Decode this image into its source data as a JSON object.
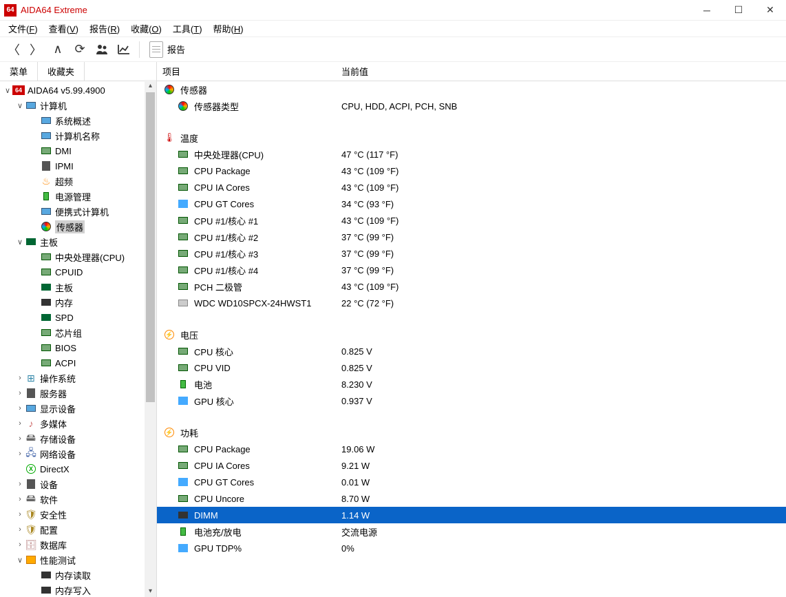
{
  "window": {
    "title": "AIDA64 Extreme",
    "icon_text": "64"
  },
  "menu": [
    {
      "l": "文件(",
      "u": "F",
      "r": ")"
    },
    {
      "l": "查看(",
      "u": "V",
      "r": ")"
    },
    {
      "l": "报告(",
      "u": "R",
      "r": ")"
    },
    {
      "l": "收藏(",
      "u": "O",
      "r": ")"
    },
    {
      "l": "工具(",
      "u": "T",
      "r": ")"
    },
    {
      "l": "帮助(",
      "u": "H",
      "r": ")"
    }
  ],
  "toolbar": {
    "report_label": "报告"
  },
  "sidebar": {
    "tabs": [
      "菜单",
      "收藏夹"
    ],
    "root": "AIDA64 v5.99.4900"
  },
  "tree": [
    {
      "level": 2,
      "exp": "open",
      "icon": "monitor",
      "label": "计算机"
    },
    {
      "level": 3,
      "icon": "monitor",
      "label": "系统概述"
    },
    {
      "level": 3,
      "icon": "monitor",
      "label": "计算机名称"
    },
    {
      "level": 3,
      "icon": "chip",
      "label": "DMI"
    },
    {
      "level": 3,
      "icon": "serv",
      "label": "IPMI"
    },
    {
      "level": 3,
      "icon": "fire",
      "label": "超频"
    },
    {
      "level": 3,
      "icon": "batt",
      "label": "电源管理"
    },
    {
      "level": 3,
      "icon": "monitor",
      "label": "便携式计算机"
    },
    {
      "level": 3,
      "icon": "sensor",
      "label": "传感器",
      "sel": true
    },
    {
      "level": 2,
      "exp": "open",
      "icon": "board",
      "label": "主板"
    },
    {
      "level": 3,
      "icon": "chip",
      "label": "中央处理器(CPU)"
    },
    {
      "level": 3,
      "icon": "chip",
      "label": "CPUID"
    },
    {
      "level": 3,
      "icon": "board",
      "label": "主板"
    },
    {
      "level": 3,
      "icon": "dark",
      "label": "内存"
    },
    {
      "level": 3,
      "icon": "board",
      "label": "SPD"
    },
    {
      "level": 3,
      "icon": "chip",
      "label": "芯片组"
    },
    {
      "level": 3,
      "icon": "chip",
      "label": "BIOS"
    },
    {
      "level": 3,
      "icon": "chip",
      "label": "ACPI"
    },
    {
      "level": 2,
      "exp": "closed",
      "icon": "win",
      "label": "操作系统"
    },
    {
      "level": 2,
      "exp": "closed",
      "icon": "serv",
      "label": "服务器"
    },
    {
      "level": 2,
      "exp": "closed",
      "icon": "monitor",
      "label": "显示设备"
    },
    {
      "level": 2,
      "exp": "closed",
      "icon": "aud",
      "label": "多媒体"
    },
    {
      "level": 2,
      "exp": "closed",
      "icon": "stor",
      "label": "存储设备"
    },
    {
      "level": 2,
      "exp": "closed",
      "icon": "net",
      "label": "网络设备"
    },
    {
      "level": 2,
      "exp": "",
      "icon": "dx",
      "label": "DirectX"
    },
    {
      "level": 2,
      "exp": "closed",
      "icon": "serv",
      "label": "设备"
    },
    {
      "level": 2,
      "exp": "closed",
      "icon": "stor",
      "label": "软件"
    },
    {
      "level": 2,
      "exp": "closed",
      "icon": "sec",
      "label": "安全性"
    },
    {
      "level": 2,
      "exp": "closed",
      "icon": "sec",
      "label": "配置"
    },
    {
      "level": 2,
      "exp": "closed",
      "icon": "db",
      "label": "数据库"
    },
    {
      "level": 2,
      "exp": "open",
      "icon": "perf",
      "label": "性能测试"
    },
    {
      "level": 3,
      "icon": "dark",
      "label": "内存读取"
    },
    {
      "level": 3,
      "icon": "dark",
      "label": "内存写入"
    }
  ],
  "content": {
    "headers": [
      "项目",
      "当前值"
    ],
    "sections": [
      {
        "title": "传感器",
        "icon": "sensor",
        "rows": [
          {
            "icon": "sensor",
            "label": "传感器类型",
            "value": "CPU, HDD, ACPI, PCH, SNB"
          }
        ]
      },
      {
        "title": "温度",
        "icon": "therm",
        "rows": [
          {
            "icon": "chip",
            "label": "中央处理器(CPU)",
            "value": "47 °C  (117 °F)"
          },
          {
            "icon": "chip",
            "label": "CPU Package",
            "value": "43 °C  (109 °F)"
          },
          {
            "icon": "chip",
            "label": "CPU IA Cores",
            "value": "43 °C  (109 °F)"
          },
          {
            "icon": "blue",
            "label": "CPU GT Cores",
            "value": "34 °C  (93 °F)"
          },
          {
            "icon": "chip",
            "label": "CPU #1/核心 #1",
            "value": "43 °C  (109 °F)"
          },
          {
            "icon": "chip",
            "label": "CPU #1/核心 #2",
            "value": "37 °C  (99 °F)"
          },
          {
            "icon": "chip",
            "label": "CPU #1/核心 #3",
            "value": "37 °C  (99 °F)"
          },
          {
            "icon": "chip",
            "label": "CPU #1/核心 #4",
            "value": "37 °C  (99 °F)"
          },
          {
            "icon": "chip",
            "label": "PCH 二极管",
            "value": "43 °C  (109 °F)"
          },
          {
            "icon": "grey",
            "label": "WDC WD10SPCX-24HWST1",
            "value": "22 °C  (72 °F)"
          }
        ]
      },
      {
        "title": "电压",
        "icon": "volt",
        "rows": [
          {
            "icon": "chip",
            "label": "CPU 核心",
            "value": "0.825 V"
          },
          {
            "icon": "chip",
            "label": "CPU VID",
            "value": "0.825 V"
          },
          {
            "icon": "batt",
            "label": "电池",
            "value": "8.230 V"
          },
          {
            "icon": "blue",
            "label": "GPU 核心",
            "value": "0.937 V"
          }
        ]
      },
      {
        "title": "功耗",
        "icon": "volt",
        "rows": [
          {
            "icon": "chip",
            "label": "CPU Package",
            "value": "19.06 W"
          },
          {
            "icon": "chip",
            "label": "CPU IA Cores",
            "value": "9.21 W"
          },
          {
            "icon": "blue",
            "label": "CPU GT Cores",
            "value": "0.01 W"
          },
          {
            "icon": "chip",
            "label": "CPU Uncore",
            "value": "8.70 W"
          },
          {
            "icon": "dark",
            "label": "DIMM",
            "value": "1.14 W",
            "sel": true
          },
          {
            "icon": "batt",
            "label": "电池充/放电",
            "value": "交流电源"
          },
          {
            "icon": "blue",
            "label": "GPU TDP%",
            "value": "0%"
          }
        ]
      }
    ]
  }
}
